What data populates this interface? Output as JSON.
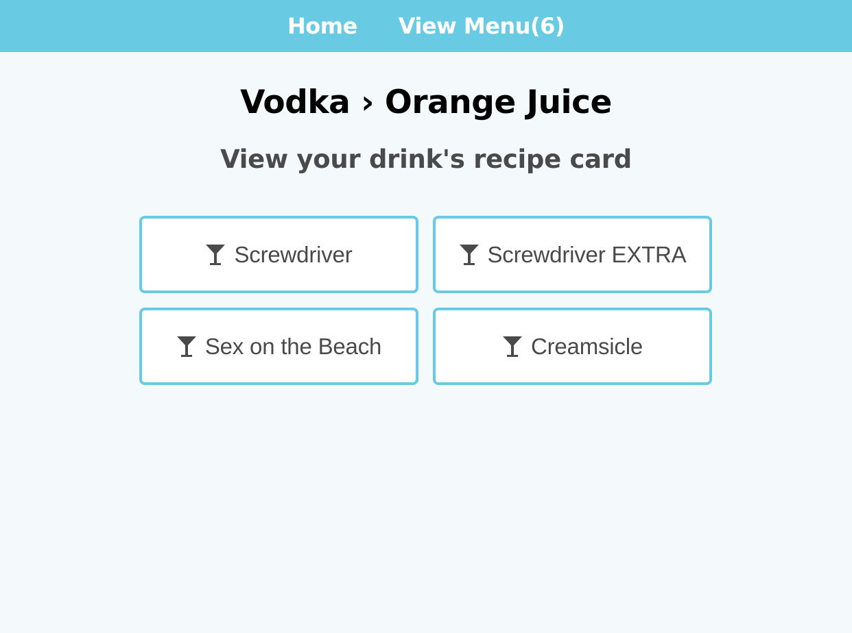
{
  "nav": {
    "home_label": "Home",
    "menu_label": "View Menu(6)"
  },
  "header": {
    "title": "Vodka › Orange Juice",
    "subtitle": "View your drink's recipe card"
  },
  "drinks": [
    {
      "label": "Screwdriver",
      "icon": "cocktail-glass-icon"
    },
    {
      "label": "Screwdriver EXTRA",
      "icon": "cocktail-glass-icon"
    },
    {
      "label": "Sex on the Beach",
      "icon": "cocktail-glass-icon"
    },
    {
      "label": "Creamsicle",
      "icon": "cocktail-glass-icon"
    }
  ],
  "colors": {
    "accent": "#69cae4",
    "background": "#f4f9fc",
    "text": "#4a4a4a"
  }
}
